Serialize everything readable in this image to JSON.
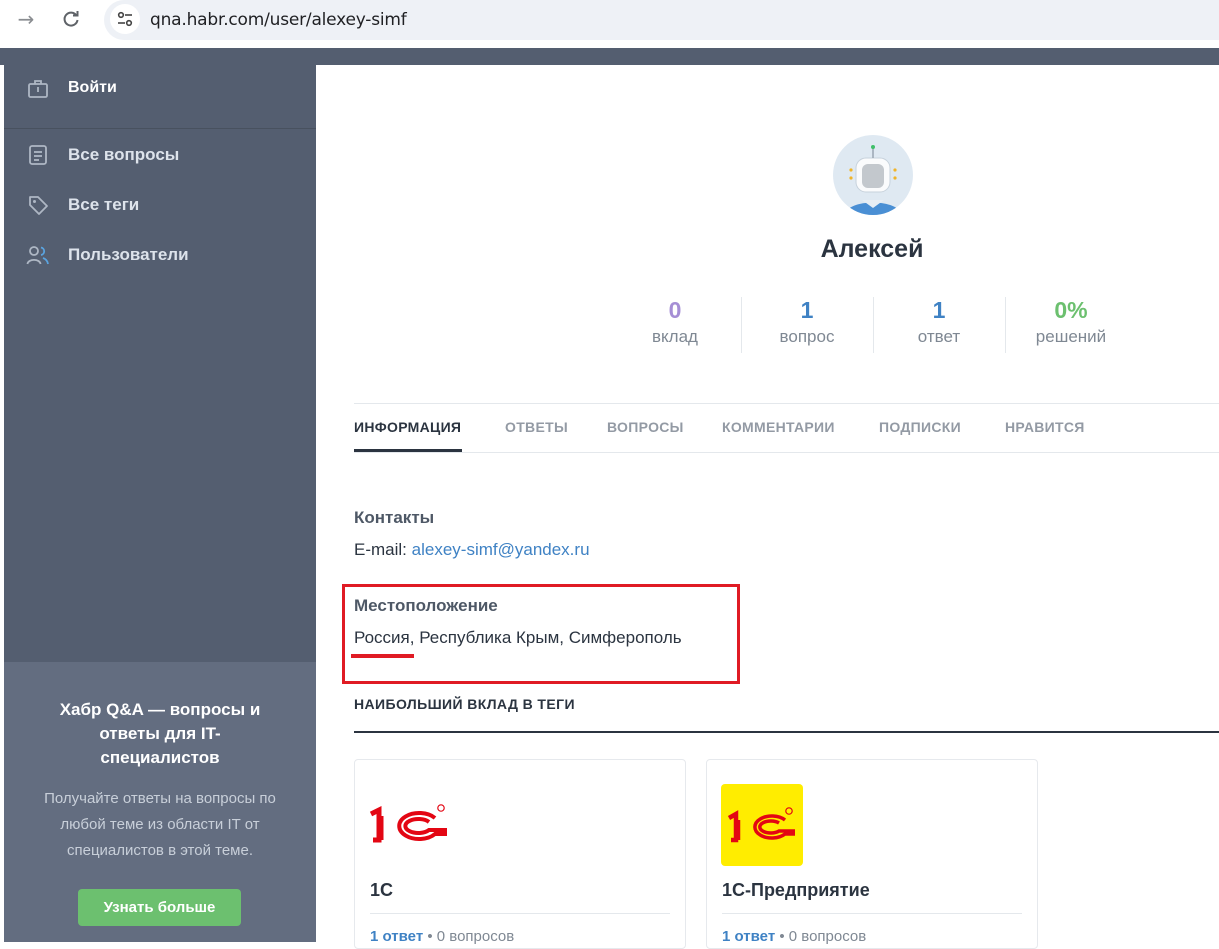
{
  "browser": {
    "url": "qna.habr.com/user/alexey-simf"
  },
  "sidebar": {
    "login": "Войти",
    "items": [
      {
        "label": "Все вопросы",
        "icon": "questions-list-icon"
      },
      {
        "label": "Все теги",
        "icon": "tag-icon"
      },
      {
        "label": "Пользователи",
        "icon": "users-icon"
      }
    ],
    "promo": {
      "title": "Хабр Q&A — вопросы и ответы для IT-специалистов",
      "text": "Получайте ответы на вопросы по любой теме из области IT от специалистов в этой теме.",
      "button": "Узнать больше"
    }
  },
  "profile": {
    "name": "Алексей",
    "stats": [
      {
        "value": "0",
        "caption": "вклад",
        "color": "#a58ed5"
      },
      {
        "value": "1",
        "caption": "вопрос",
        "color": "#3f82c4"
      },
      {
        "value": "1",
        "caption": "ответ",
        "color": "#3f82c4"
      },
      {
        "value": "0%",
        "caption": "решений",
        "color": "#6cc06f"
      }
    ]
  },
  "tabs": [
    "ИНФОРМАЦИЯ",
    "ОТВЕТЫ",
    "ВОПРОСЫ",
    "КОММЕНТАРИИ",
    "ПОДПИСКИ",
    "НРАВИТСЯ"
  ],
  "info": {
    "contacts_title": "Контакты",
    "email_label": "E-mail:",
    "email": "alexey-simf@yandex.ru",
    "location_title": "Местоположение",
    "location_country": "Россия",
    "location_rest": ", Республика Крым, Симферополь"
  },
  "tags_section": {
    "title": "НАИБОЛЬШИЙ ВКЛАД В ТЕГИ",
    "cards": [
      {
        "name": "1С",
        "answers": "1 ответ",
        "sep": "•",
        "questions": "0 вопросов"
      },
      {
        "name": "1С-Предприятие",
        "answers": "1 ответ",
        "sep": "•",
        "questions": "0 вопросов"
      }
    ]
  },
  "colors": {
    "sidebar_bg": "#545e70",
    "accent_link": "#3f82c4",
    "highlight_red": "#e01b24",
    "button_green": "#6cc06f"
  }
}
